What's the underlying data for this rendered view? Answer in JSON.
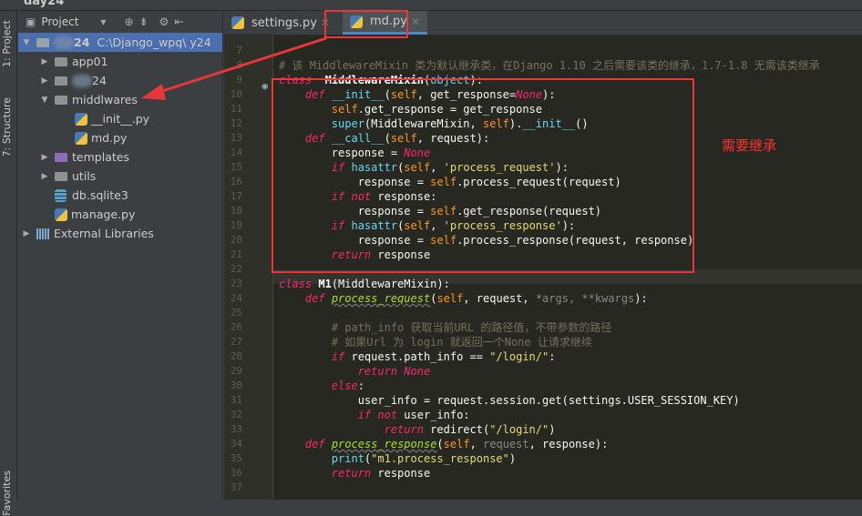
{
  "window": {
    "title": "day24"
  },
  "side_tabs": [
    "1: Project",
    "7: Structure",
    "Favorites"
  ],
  "project_panel": {
    "title": "Project",
    "root": {
      "name": "24",
      "path": "C:\\Django_wpq\\  y24"
    },
    "items": [
      {
        "name": "app01",
        "type": "folder",
        "depth": 1,
        "state": "collapsed"
      },
      {
        "name": "24",
        "type": "folder",
        "depth": 1,
        "state": "collapsed"
      },
      {
        "name": "middlwares",
        "type": "folder",
        "depth": 1,
        "state": "expanded"
      },
      {
        "name": "__init__.py",
        "type": "python",
        "depth": 2
      },
      {
        "name": "md.py",
        "type": "python",
        "depth": 2
      },
      {
        "name": "templates",
        "type": "folder-templates",
        "depth": 1,
        "state": "collapsed"
      },
      {
        "name": "utils",
        "type": "folder",
        "depth": 1,
        "state": "collapsed"
      },
      {
        "name": "db.sqlite3",
        "type": "database",
        "depth": 1
      },
      {
        "name": "manage.py",
        "type": "python",
        "depth": 1
      }
    ],
    "external": "External Libraries"
  },
  "tabs": [
    {
      "label": "settings.py",
      "active": false
    },
    {
      "label": "md.py",
      "active": true
    }
  ],
  "annotation": {
    "text": "需要继承",
    "color": "#ff3030"
  },
  "code": {
    "first_line": 7,
    "lines": [
      [],
      [
        [
          "cm",
          "# 该 MiddlewareMixin 类为默认继承类，在Django 1.10 之后需要该类的继承，1.7-1.8 无需该类继承"
        ]
      ],
      [
        [
          "kw",
          "class"
        ],
        [
          "",
          "  "
        ],
        [
          "cls",
          "MiddlewareMixin"
        ],
        [
          "",
          "("
        ],
        [
          "bi",
          "object"
        ],
        [
          "",
          "):"
        ]
      ],
      [
        [
          "",
          "    "
        ],
        [
          "kw",
          "def"
        ],
        [
          "",
          " "
        ],
        [
          "bi",
          "__init__"
        ],
        [
          "",
          "("
        ],
        [
          "self",
          "self"
        ],
        [
          "",
          ", get_response="
        ],
        [
          "kw",
          "None"
        ],
        [
          "",
          "):"
        ]
      ],
      [
        [
          "",
          "        "
        ],
        [
          "self",
          "self"
        ],
        [
          "",
          ".get_response = get_response"
        ]
      ],
      [
        [
          "",
          "        "
        ],
        [
          "bi",
          "super"
        ],
        [
          "",
          "(MiddlewareMixin, "
        ],
        [
          "self",
          "self"
        ],
        [
          "",
          ")."
        ],
        [
          "bi",
          "__init__"
        ],
        [
          "",
          "()"
        ]
      ],
      [
        [
          "",
          "    "
        ],
        [
          "kw",
          "def"
        ],
        [
          "",
          " "
        ],
        [
          "bi",
          "__call__"
        ],
        [
          "",
          "("
        ],
        [
          "self",
          "self"
        ],
        [
          "",
          ", request):"
        ]
      ],
      [
        [
          "",
          "        response = "
        ],
        [
          "kw",
          "None"
        ]
      ],
      [
        [
          "",
          "        "
        ],
        [
          "kw",
          "if"
        ],
        [
          "",
          " "
        ],
        [
          "bi",
          "hasattr"
        ],
        [
          "",
          "("
        ],
        [
          "self",
          "self"
        ],
        [
          "",
          ", "
        ],
        [
          "str",
          "'process_request'"
        ],
        [
          "",
          "):"
        ]
      ],
      [
        [
          "",
          "            response = "
        ],
        [
          "self",
          "self"
        ],
        [
          "",
          ".process_request(request)"
        ]
      ],
      [
        [
          "",
          "        "
        ],
        [
          "kw",
          "if not"
        ],
        [
          "",
          " response:"
        ]
      ],
      [
        [
          "",
          "            response = "
        ],
        [
          "self",
          "self"
        ],
        [
          "",
          ".get_response(request)"
        ]
      ],
      [
        [
          "",
          "        "
        ],
        [
          "kw",
          "if"
        ],
        [
          "",
          " "
        ],
        [
          "bi",
          "hasattr"
        ],
        [
          "",
          "("
        ],
        [
          "self",
          "self"
        ],
        [
          "",
          ", "
        ],
        [
          "str",
          "'process_response'"
        ],
        [
          "",
          "):"
        ]
      ],
      [
        [
          "",
          "            response = "
        ],
        [
          "self",
          "self"
        ],
        [
          "",
          ".process_response(request, response)"
        ]
      ],
      [
        [
          "",
          "        "
        ],
        [
          "kw",
          "return"
        ],
        [
          "",
          " response"
        ]
      ],
      [],
      [
        [
          "kw",
          "class"
        ],
        [
          "",
          " "
        ],
        [
          "cls",
          "M1"
        ],
        [
          "",
          "(MiddlewareMixin):"
        ]
      ],
      [
        [
          "",
          "    "
        ],
        [
          "kw",
          "def"
        ],
        [
          "",
          " "
        ],
        [
          "fn",
          "process_request"
        ],
        [
          "",
          "("
        ],
        [
          "self",
          "self"
        ],
        [
          "",
          ", request, "
        ],
        [
          "pm",
          "*args, **kwargs"
        ],
        [
          "",
          "):"
        ]
      ],
      [],
      [
        [
          "",
          "        "
        ],
        [
          "cm",
          "# path_info 获取当前URL 的路径值，不带参数的路径"
        ]
      ],
      [
        [
          "",
          "        "
        ],
        [
          "cm",
          "# 如果Url 为 login 就返回一个None 让请求继续"
        ]
      ],
      [
        [
          "",
          "        "
        ],
        [
          "kw",
          "if"
        ],
        [
          "",
          " request.path_info == "
        ],
        [
          "str",
          "\"/login/\""
        ],
        [
          "",
          ":"
        ]
      ],
      [
        [
          "",
          "            "
        ],
        [
          "kw",
          "return None"
        ]
      ],
      [
        [
          "",
          "        "
        ],
        [
          "kw",
          "else"
        ],
        [
          "",
          ":"
        ]
      ],
      [
        [
          "",
          "            user_info = request.session.get(settings.USER_SESSION_KEY)"
        ]
      ],
      [
        [
          "",
          "            "
        ],
        [
          "kw",
          "if not"
        ],
        [
          "",
          " user_info:"
        ]
      ],
      [
        [
          "",
          "                "
        ],
        [
          "kw",
          "return"
        ],
        [
          "",
          " redirect("
        ],
        [
          "str",
          "\"/login/\""
        ],
        [
          "",
          ")"
        ]
      ],
      [
        [
          "",
          "    "
        ],
        [
          "kw",
          "def"
        ],
        [
          "",
          " "
        ],
        [
          "fn",
          "process_response"
        ],
        [
          "",
          "("
        ],
        [
          "self",
          "self"
        ],
        [
          "",
          ", "
        ],
        [
          "pm",
          "request"
        ],
        [
          "",
          ", response):"
        ]
      ],
      [
        [
          "",
          "        "
        ],
        [
          "bi",
          "print"
        ],
        [
          "",
          "("
        ],
        [
          "str",
          "\"m1.process_response\""
        ],
        [
          "",
          ")"
        ]
      ],
      [
        [
          "",
          "        "
        ],
        [
          "kw",
          "return"
        ],
        [
          "",
          " response"
        ]
      ],
      []
    ]
  }
}
